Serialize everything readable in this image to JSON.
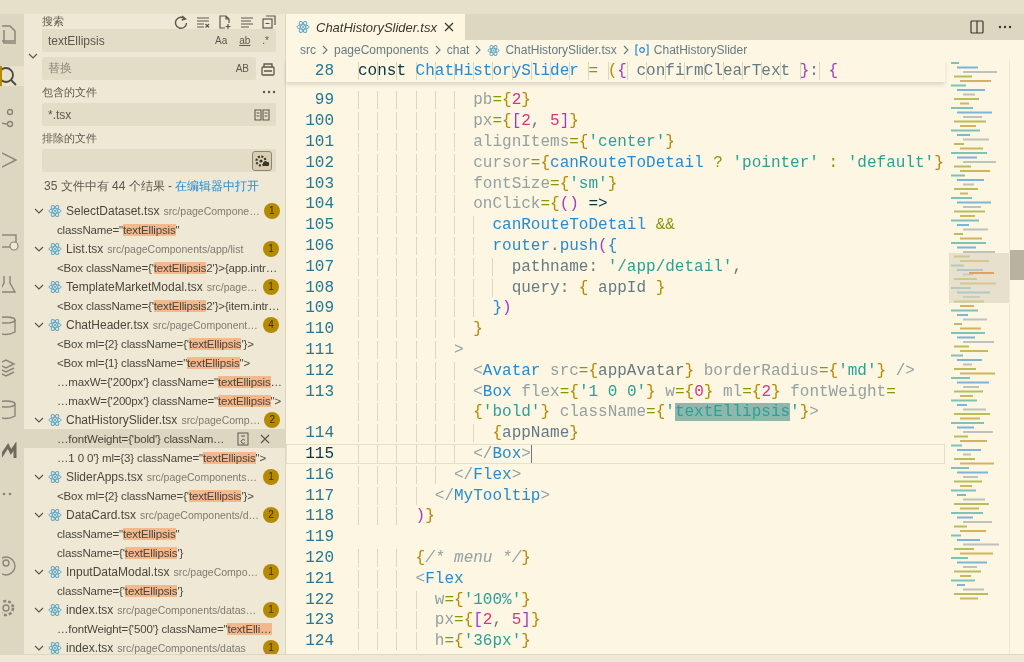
{
  "activity_bar": [
    {
      "kind": "files",
      "selected": false
    },
    {
      "kind": "search",
      "selected": true
    },
    {
      "kind": "branch",
      "selected": false
    },
    {
      "kind": "run",
      "selected": false
    },
    {
      "kind": "remote",
      "selected": false
    },
    {
      "kind": "flask",
      "selected": false
    },
    {
      "kind": "database",
      "selected": false
    },
    {
      "kind": "layers",
      "selected": false
    },
    {
      "kind": "database",
      "selected": false
    },
    {
      "kind": "logo",
      "selected": false
    },
    {
      "kind": "more",
      "selected": false
    },
    {
      "kind": "account",
      "selected": false
    },
    {
      "kind": "settings",
      "selected": false
    }
  ],
  "search_panel": {
    "title": "搜索",
    "replace_expanded": true,
    "query": {
      "value": "textEllipsis",
      "toggles": [
        {
          "label": "Aa",
          "on": false
        },
        {
          "label": "ab",
          "on": false
        },
        {
          "label": ".*",
          "on": false
        }
      ]
    },
    "replace": {
      "placeholder": "替换",
      "toggle": {
        "label": "AB",
        "on": false
      }
    },
    "include": {
      "label": "包含的文件",
      "value": "*.tsx",
      "open_editors_only": false
    },
    "exclude": {
      "label": "排除的文件",
      "use_exclude_settings": true
    },
    "summary": {
      "text": "35 文件中有 44 个结果 - ",
      "link": "在编辑器中打开"
    },
    "results": [
      {
        "name": "SelectDataset.tsx",
        "path": "src/pageCompone…",
        "count": "1",
        "expanded": true,
        "matches": [
          {
            "before": "className=\"",
            "match": "textEllipsis",
            "after": "\"",
            "selected": false
          }
        ]
      },
      {
        "name": "List.tsx",
        "path": "src/pageComponents/app/list",
        "count": "1",
        "expanded": true,
        "matches": [
          {
            "before": "<Box className={'",
            "match": "textEllipsis",
            "after": "2'}>{app.intr…",
            "selected": false
          }
        ]
      },
      {
        "name": "TemplateMarketModal.tsx",
        "path": "src/page…",
        "count": "1",
        "expanded": true,
        "matches": [
          {
            "before": "<Box className={'",
            "match": "textEllipsis",
            "after": "2'}>{item.intr…",
            "selected": false
          }
        ]
      },
      {
        "name": "ChatHeader.tsx",
        "path": "src/pageComponent…",
        "count": "4",
        "expanded": true,
        "matches": [
          {
            "before": "<Box ml={2} className={'",
            "match": "textEllipsis",
            "after": "'}>",
            "selected": false
          },
          {
            "before": "<Box ml={1} className=\"",
            "match": "textEllipsis",
            "after": "\">",
            "selected": false
          },
          {
            "before": "…maxW={'200px'} className=\"",
            "match": "textEllipsis",
            "after": "…",
            "selected": false
          },
          {
            "before": "…maxW={'200px'} className=\"",
            "match": "textEllipsis",
            "after": "\">",
            "selected": false
          }
        ]
      },
      {
        "name": "ChatHistorySlider.tsx",
        "path": "src/pageComp…",
        "count": "2",
        "expanded": true,
        "matches": [
          {
            "before": "…fontWeight={'bold'} classNam…",
            "selected": true
          },
          {
            "before": "…1 0 0'} ml={3} className=\"",
            "match": "textEllipsis",
            "after": "\">",
            "selected": false
          }
        ]
      },
      {
        "name": "SliderApps.tsx",
        "path": "src/pageComponents…",
        "count": "1",
        "expanded": true,
        "matches": [
          {
            "before": "<Box ml={2} className={'",
            "match": "textEllipsis",
            "after": "'}>",
            "selected": false
          }
        ]
      },
      {
        "name": "DataCard.tsx",
        "path": "src/pageComponents/d…",
        "count": "2",
        "expanded": true,
        "matches": [
          {
            "before": "className=\"",
            "match": "textEllipsis",
            "after": "\"",
            "selected": false
          },
          {
            "before": "className={'",
            "match": "textEllipsis",
            "after": "'}",
            "selected": false
          }
        ]
      },
      {
        "name": "InputDataModal.tsx",
        "path": "src/pageCompo…",
        "count": "1",
        "expanded": true,
        "matches": [
          {
            "before": "className={'",
            "match": "textEllipsis",
            "after": "'}",
            "selected": false
          }
        ]
      },
      {
        "name": "index.tsx",
        "path": "src/pageComponents/datas…",
        "count": "1",
        "expanded": true,
        "matches": [
          {
            "before": "…fontWeight={'500'} className=\"",
            "match": "textElli…",
            "selected": false
          }
        ]
      },
      {
        "name": "index.tsx",
        "path": "src/pageComponents/datas",
        "count": "1",
        "expanded": true
      }
    ]
  },
  "editor": {
    "tab": {
      "title": "ChatHistorySlider.tsx",
      "preview": true
    },
    "breadcrumbs": [
      {
        "kind": "folder",
        "label": "src"
      },
      {
        "kind": "folder",
        "label": "pageComponents"
      },
      {
        "kind": "folder",
        "label": "chat"
      },
      {
        "kind": "file",
        "label": "ChatHistorySlider.tsx"
      },
      {
        "kind": "symbol",
        "label": "ChatHistorySlider"
      }
    ],
    "sticky_line": {
      "number": "28",
      "tokens": [
        {
          "kind": "kw",
          "text": "const "
        },
        {
          "kind": "fn",
          "text": "ChatHistorySlider"
        },
        {
          "kind": "op",
          "text": " = "
        },
        {
          "kind": "b1",
          "text": "("
        },
        {
          "kind": "b2",
          "text": "{"
        },
        {
          "kind": "plain",
          "text": " confirmClearText "
        },
        {
          "kind": "b2",
          "text": "}"
        },
        {
          "kind": "plain",
          "text": ": "
        },
        {
          "kind": "b2",
          "text": "{"
        }
      ]
    },
    "lines": [
      {
        "number": "99",
        "tokens": [
          {
            "kind": "attr",
            "text": "            pb"
          },
          {
            "kind": "op",
            "text": "="
          },
          {
            "kind": "b1",
            "text": "{"
          },
          {
            "kind": "num",
            "text": "2"
          },
          {
            "kind": "b1",
            "text": "}"
          }
        ]
      },
      {
        "number": "100",
        "tokens": [
          {
            "kind": "attr",
            "text": "            px"
          },
          {
            "kind": "op",
            "text": "="
          },
          {
            "kind": "b1",
            "text": "{"
          },
          {
            "kind": "b2",
            "text": "["
          },
          {
            "kind": "num",
            "text": "2"
          },
          {
            "kind": "plain",
            "text": ", "
          },
          {
            "kind": "num",
            "text": "5"
          },
          {
            "kind": "b2",
            "text": "]"
          },
          {
            "kind": "b1",
            "text": "}"
          }
        ]
      },
      {
        "number": "101",
        "tokens": [
          {
            "kind": "attr",
            "text": "            alignItems"
          },
          {
            "kind": "op",
            "text": "="
          },
          {
            "kind": "b1",
            "text": "{"
          },
          {
            "kind": "str",
            "text": "'center'"
          },
          {
            "kind": "b1",
            "text": "}"
          }
        ]
      },
      {
        "number": "102",
        "tokens": [
          {
            "kind": "attr",
            "text": "            cursor"
          },
          {
            "kind": "op",
            "text": "="
          },
          {
            "kind": "b1",
            "text": "{"
          },
          {
            "kind": "fn",
            "text": "canRouteToDetail"
          },
          {
            "kind": "op",
            "text": " ? "
          },
          {
            "kind": "str",
            "text": "'pointer'"
          },
          {
            "kind": "op",
            "text": " : "
          },
          {
            "kind": "str",
            "text": "'default'"
          },
          {
            "kind": "b1",
            "text": "}"
          }
        ]
      },
      {
        "number": "103",
        "tokens": [
          {
            "kind": "attr",
            "text": "            fontSize"
          },
          {
            "kind": "op",
            "text": "="
          },
          {
            "kind": "b1",
            "text": "{"
          },
          {
            "kind": "str",
            "text": "'sm'"
          },
          {
            "kind": "b1",
            "text": "}"
          }
        ]
      },
      {
        "number": "104",
        "tokens": [
          {
            "kind": "attr",
            "text": "            onClick"
          },
          {
            "kind": "op",
            "text": "="
          },
          {
            "kind": "b1",
            "text": "{"
          },
          {
            "kind": "b2",
            "text": "()"
          },
          {
            "kind": "kw",
            "text": " =>"
          }
        ]
      },
      {
        "number": "105",
        "tokens": [
          {
            "kind": "fn",
            "text": "              canRouteToDetail"
          },
          {
            "kind": "op",
            "text": " &&"
          }
        ]
      },
      {
        "number": "106",
        "tokens": [
          {
            "kind": "fn",
            "text": "              router"
          },
          {
            "kind": "plain",
            "text": "."
          },
          {
            "kind": "fn",
            "text": "push"
          },
          {
            "kind": "b2",
            "text": "("
          },
          {
            "kind": "b3",
            "text": "{"
          }
        ]
      },
      {
        "number": "107",
        "tokens": [
          {
            "kind": "plain",
            "text": "                pathname: "
          },
          {
            "kind": "str",
            "text": "'/app/detail'"
          },
          {
            "kind": "plain",
            "text": ","
          }
        ]
      },
      {
        "number": "108",
        "tokens": [
          {
            "kind": "plain",
            "text": "                query: "
          },
          {
            "kind": "b1",
            "text": "{"
          },
          {
            "kind": "plain",
            "text": " appId "
          },
          {
            "kind": "b1",
            "text": "}"
          }
        ]
      },
      {
        "number": "109",
        "tokens": [
          {
            "kind": "b3",
            "text": "              }"
          },
          {
            "kind": "b2",
            "text": ")"
          }
        ]
      },
      {
        "number": "110",
        "tokens": [
          {
            "kind": "b1",
            "text": "            }"
          }
        ]
      },
      {
        "number": "111",
        "tokens": [
          {
            "kind": "pun",
            "text": "          >"
          }
        ]
      },
      {
        "number": "112",
        "tokens": [
          {
            "kind": "pun",
            "text": "            <"
          },
          {
            "kind": "fn",
            "text": "Avatar"
          },
          {
            "kind": "attr",
            "text": " src"
          },
          {
            "kind": "op",
            "text": "="
          },
          {
            "kind": "b1",
            "text": "{"
          },
          {
            "kind": "plain",
            "text": "appAvatar"
          },
          {
            "kind": "b1",
            "text": "}"
          },
          {
            "kind": "attr",
            "text": " borderRadius"
          },
          {
            "kind": "op",
            "text": "="
          },
          {
            "kind": "b1",
            "text": "{"
          },
          {
            "kind": "str",
            "text": "'md'"
          },
          {
            "kind": "b1",
            "text": "}"
          },
          {
            "kind": "pun",
            "text": " />"
          }
        ]
      },
      {
        "number": "113",
        "tokens": [
          {
            "kind": "pun",
            "text": "            <"
          },
          {
            "kind": "fn",
            "text": "Box"
          },
          {
            "kind": "attr",
            "text": " flex"
          },
          {
            "kind": "op",
            "text": "="
          },
          {
            "kind": "b1",
            "text": "{"
          },
          {
            "kind": "str",
            "text": "'1 0 0'"
          },
          {
            "kind": "b1",
            "text": "}"
          },
          {
            "kind": "attr",
            "text": " w"
          },
          {
            "kind": "op",
            "text": "="
          },
          {
            "kind": "b1",
            "text": "{"
          },
          {
            "kind": "num",
            "text": "0"
          },
          {
            "kind": "b1",
            "text": "}"
          },
          {
            "kind": "attr",
            "text": " ml"
          },
          {
            "kind": "op",
            "text": "="
          },
          {
            "kind": "b1",
            "text": "{"
          },
          {
            "kind": "num",
            "text": "2"
          },
          {
            "kind": "b1",
            "text": "}"
          },
          {
            "kind": "attr",
            "text": " fontWeight"
          },
          {
            "kind": "op",
            "text": "="
          }
        ],
        "wrap": [
          {
            "kind": "b1",
            "text": "            {"
          },
          {
            "kind": "str",
            "text": "'bold'"
          },
          {
            "kind": "b1",
            "text": "}"
          },
          {
            "kind": "attr",
            "text": " className"
          },
          {
            "kind": "op",
            "text": "="
          },
          {
            "kind": "b1",
            "text": "{"
          },
          {
            "kind": "str",
            "text": "'"
          },
          {
            "kind": "match",
            "text": "textEllipsis"
          },
          {
            "kind": "str",
            "text": "'"
          },
          {
            "kind": "b1",
            "text": "}"
          },
          {
            "kind": "pun",
            "text": ">"
          }
        ]
      },
      {
        "number": "114",
        "tokens": [
          {
            "kind": "b1",
            "text": "              {"
          },
          {
            "kind": "plain",
            "text": "appName"
          },
          {
            "kind": "b1",
            "text": "}"
          }
        ]
      },
      {
        "number": "115",
        "current": true,
        "tokens": [
          {
            "kind": "pun",
            "text": "            </"
          },
          {
            "kind": "fn",
            "text": "Box"
          },
          {
            "kind": "pun",
            "text": ">"
          }
        ]
      },
      {
        "number": "116",
        "current": false,
        "tokens": [
          {
            "kind": "pun",
            "text": "          </"
          },
          {
            "kind": "fn",
            "text": "Flex"
          },
          {
            "kind": "pun",
            "text": ">"
          }
        ]
      },
      {
        "number": "117",
        "tokens": [
          {
            "kind": "pun",
            "text": "        </"
          },
          {
            "kind": "fn",
            "text": "MyTooltip"
          },
          {
            "kind": "pun",
            "text": ">"
          }
        ]
      },
      {
        "number": "118",
        "tokens": [
          {
            "kind": "b2",
            "text": "      )"
          },
          {
            "kind": "b1",
            "text": "}"
          }
        ]
      },
      {
        "number": "119"
      },
      {
        "number": "120",
        "tokens": [
          {
            "kind": "b1",
            "text": "      {"
          },
          {
            "kind": "cm",
            "text": "/* menu */"
          },
          {
            "kind": "b1",
            "text": "}"
          }
        ]
      },
      {
        "number": "121",
        "tokens": [
          {
            "kind": "pun",
            "text": "      <"
          },
          {
            "kind": "fn",
            "text": "Flex"
          }
        ]
      },
      {
        "number": "122",
        "tokens": [
          {
            "kind": "attr",
            "text": "        w"
          },
          {
            "kind": "op",
            "text": "="
          },
          {
            "kind": "b1",
            "text": "{"
          },
          {
            "kind": "str",
            "text": "'100%'"
          },
          {
            "kind": "b1",
            "text": "}"
          }
        ]
      },
      {
        "number": "123",
        "tokens": [
          {
            "kind": "attr",
            "text": "        px"
          },
          {
            "kind": "op",
            "text": "="
          },
          {
            "kind": "b1",
            "text": "{"
          },
          {
            "kind": "b2",
            "text": "["
          },
          {
            "kind": "num",
            "text": "2"
          },
          {
            "kind": "plain",
            "text": ", "
          },
          {
            "kind": "num",
            "text": "5"
          },
          {
            "kind": "b2",
            "text": "]"
          },
          {
            "kind": "b1",
            "text": "}"
          }
        ]
      },
      {
        "number": "124",
        "tokens": [
          {
            "kind": "attr",
            "text": "        h"
          },
          {
            "kind": "op",
            "text": "="
          },
          {
            "kind": "b1",
            "text": "{"
          },
          {
            "kind": "str",
            "text": "'36px'"
          },
          {
            "kind": "b1",
            "text": "}"
          }
        ]
      }
    ]
  }
}
